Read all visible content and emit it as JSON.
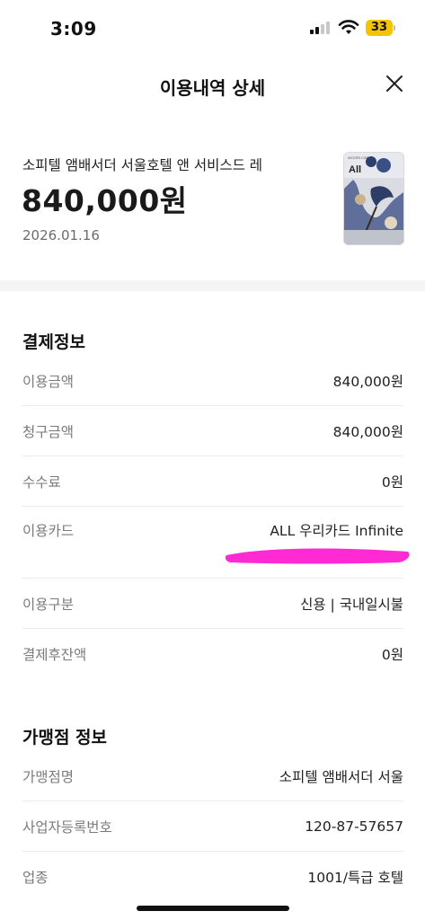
{
  "status_bar": {
    "time": "3:09",
    "battery": "33",
    "accent_color": "#f4c400"
  },
  "header": {
    "title": "이용내역 상세",
    "close_icon": "close-icon"
  },
  "summary": {
    "merchant": "소피텔 앰배서더 서울호텔 앤 서비스드 레",
    "amount": "840,000원",
    "date": "2026.01.16"
  },
  "payment_info": {
    "title": "결제정보",
    "rows": [
      {
        "label": "이용금액",
        "value": "840,000원"
      },
      {
        "label": "청구금액",
        "value": "840,000원"
      },
      {
        "label": "수수료",
        "value": "0원"
      },
      {
        "label": "이용카드",
        "value": "ALL 우리카드 Infinite"
      },
      {
        "label": "이용구분",
        "value": "신용 | 국내일시불"
      },
      {
        "label": "결제후잔액",
        "value": "0원"
      }
    ]
  },
  "merchant_info": {
    "title": "가맹점 정보",
    "rows": [
      {
        "label": "가맹점명",
        "value": "소피텔 앰배서더 서울"
      },
      {
        "label": "사업자등록번호",
        "value": "120-87-57657"
      },
      {
        "label": "업종",
        "value": "1001/특급 호텔"
      }
    ]
  },
  "card_image": {
    "text": "All",
    "label_text": "WOORI CARD",
    "icon": "card-image"
  },
  "annotation_color": "#ff2ad4"
}
